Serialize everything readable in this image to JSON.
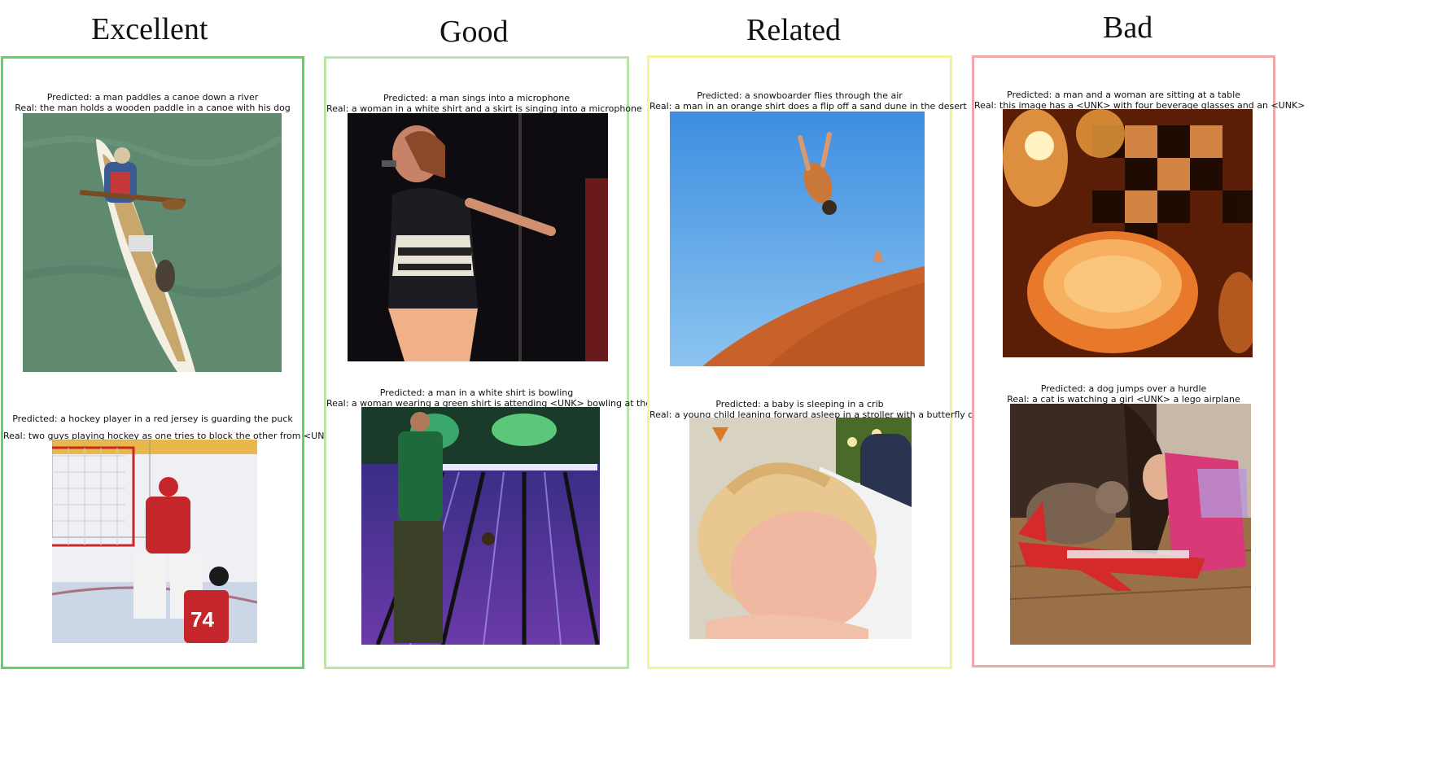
{
  "columns": [
    {
      "title": "Excellent",
      "border_color": "#5fd35f",
      "examples": [
        {
          "predicted": "Predicted: a man paddles a canoe down a river",
          "real": "Real:  the man holds a wooden paddle in a canoe with his dog"
        },
        {
          "predicted": "Predicted: a hockey player in a red jersey is guarding the puck",
          "real": "Real:  two guys playing hockey as one tries to block the other from <UNK> into the goal"
        }
      ]
    },
    {
      "title": "Good",
      "border_color": "#b8e6a6",
      "examples": [
        {
          "predicted": "Predicted: a man sings into a microphone",
          "real": "Real:  a woman in a white shirt and a skirt is singing into a microphone"
        },
        {
          "predicted": "Predicted: a man in a white shirt is bowling",
          "real": "Real:  a woman wearing a green shirt is attending <UNK> bowling at the <UNK>"
        }
      ]
    },
    {
      "title": "Related",
      "border_color": "#f4f39a",
      "examples": [
        {
          "predicted": "Predicted: a snowboarder flies through the air",
          "real": "Real:  a man in an orange shirt does a flip off a sand dune in the desert"
        },
        {
          "predicted": "Predicted: a baby is sleeping in a crib",
          "real": "Real:  a young child leaning forward asleep in a stroller with a butterfly on their head"
        }
      ]
    },
    {
      "title": "Bad",
      "border_color": "#f2a7a7",
      "examples": [
        {
          "predicted": "Predicted: a man and a woman are sitting at a table",
          "real": "Real:  this image has a <UNK> with four beverage glasses and an <UNK>"
        },
        {
          "predicted": "Predicted: a dog jumps over a hurdle",
          "real": "Real:  a cat is watching a girl <UNK> a lego airplane"
        }
      ]
    }
  ]
}
